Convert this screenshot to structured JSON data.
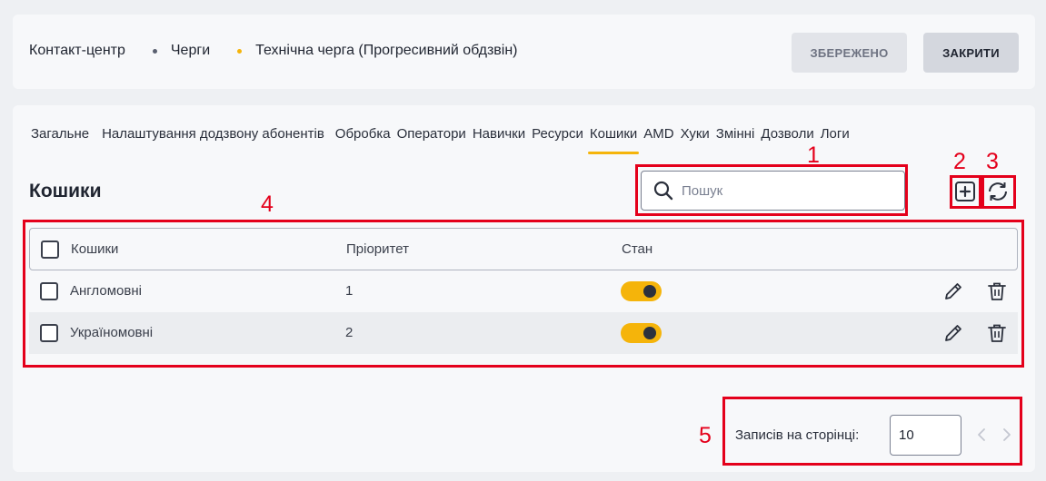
{
  "breadcrumb": [
    "Контакт-центр",
    "Черги",
    "Технічна черга (Прогресивний обдзвін)"
  ],
  "header_buttons": {
    "saved": "ЗБЕРЕЖЕНО",
    "close": "ЗАКРИТИ"
  },
  "tabs": [
    "Загальне",
    "Налаштування додзвону абонентів",
    "Обробка",
    "Оператори",
    "Навички",
    "Ресурси",
    "Кошики",
    "AMD",
    "Хуки",
    "Змінні",
    "Дозволи",
    "Логи"
  ],
  "active_tab": "Кошики",
  "section_title": "Кошики",
  "search": {
    "placeholder": "Пошук",
    "value": ""
  },
  "table": {
    "columns": [
      "Кошики",
      "Пріоритет",
      "Стан"
    ],
    "rows": [
      {
        "name": "Англомовні",
        "priority": "1",
        "state": "on"
      },
      {
        "name": "Україномовні",
        "priority": "2",
        "state": "on"
      }
    ]
  },
  "pagination": {
    "label": "Записів на сторінці:",
    "per_page": "10"
  },
  "annotations": [
    "1",
    "2",
    "3",
    "4",
    "5"
  ],
  "colors": {
    "accent": "#f5b40a",
    "annotation": "#e4001b",
    "text": "#1f2430"
  },
  "icons": [
    "search-icon",
    "plus-square-icon",
    "refresh-icon",
    "pencil-icon",
    "trash-icon",
    "chevron-left-icon",
    "chevron-right-icon"
  ]
}
